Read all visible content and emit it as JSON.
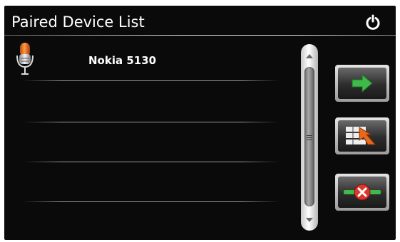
{
  "header": {
    "title": "Paired Device List",
    "power_icon": "power-icon"
  },
  "devices": [
    {
      "name": "Nokia 5130",
      "icon": "microphone-icon"
    }
  ],
  "side_buttons": [
    {
      "icon": "green-arrow-right-icon"
    },
    {
      "icon": "transfer-arrow-icon"
    },
    {
      "icon": "delete-x-icon"
    }
  ],
  "colors": {
    "background": "#0a0a0a",
    "accent_green": "#3fb94a",
    "accent_orange": "#e8681c",
    "delete_red": "#d9382e"
  }
}
